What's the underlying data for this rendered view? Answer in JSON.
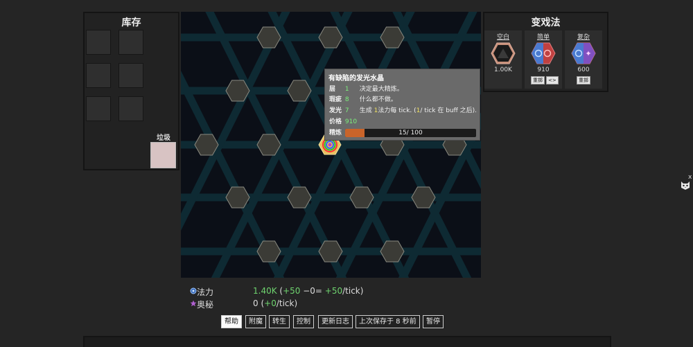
{
  "inventory": {
    "title": "库存",
    "trash_label": "垃圾"
  },
  "transmute": {
    "title": "变戏法",
    "spells": [
      {
        "name": "空白",
        "cost": "1.00K",
        "buttons": []
      },
      {
        "name": "简单",
        "cost": "910",
        "buttons": [
          "重掷",
          "<>"
        ]
      },
      {
        "name": "复杂",
        "cost": "600",
        "buttons": [
          "重掷"
        ]
      }
    ]
  },
  "tooltip": {
    "title": "有缺陷的发光水晶",
    "rows": [
      {
        "key": "层",
        "value": "1",
        "desc": "决定最大精炼。"
      },
      {
        "key": "瑕疵",
        "value": "8",
        "desc": "什么都不做。"
      },
      {
        "key": "发光",
        "value": "7",
        "desc_parts": [
          "生成 ",
          "1",
          "法力每 tick. (",
          "1",
          "/ tick 在 buff 之后)."
        ]
      },
      {
        "key": "价格",
        "value": "910"
      }
    ],
    "refine_label": "精炼",
    "refine_text": "15/ 100",
    "refine_fraction": 0.15
  },
  "stats": {
    "mana": {
      "label": "法力",
      "value": "1.40K",
      "p1": " (",
      "gain": "+50",
      "mid": " −0= ",
      "net": "+50",
      "unit": "/tick)"
    },
    "arcane": {
      "label": "奥秘",
      "value": "0",
      "p1": " (",
      "gain": "+0",
      "unit": "/tick)"
    }
  },
  "buttons": [
    "帮助",
    "附魔",
    "转生",
    "控制",
    "更新日志",
    "上次保存于 8 秒前",
    "暂停"
  ],
  "side": {
    "close": "x"
  },
  "colors": {
    "mana": "#6fd46f",
    "refine": "#c9642a",
    "board": "#0b0f17",
    "grid": "#0e2a33",
    "hex": "#3b3b36"
  },
  "icons": [
    "mana-orb-icon",
    "arcane-star-icon",
    "rainbow-crystal-icon",
    "cat-face-icon"
  ]
}
